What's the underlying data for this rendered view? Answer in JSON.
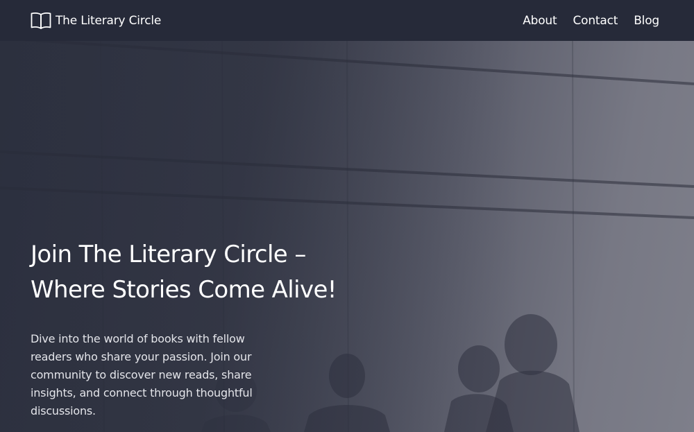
{
  "header": {
    "brand_name": "The Literary Circle",
    "brand_icon": "open-book-icon",
    "nav": [
      "About",
      "Contact",
      "Blog"
    ]
  },
  "hero": {
    "title_line1": "Join The Literary Circle –",
    "title_line2": "Where Stories Come Alive!",
    "description": "Dive into the world of books with fellow readers who share your passion. Join our community to discover new reads, share insights, and connect through thoughtful discussions."
  },
  "colors": {
    "header_bg": "#262a39",
    "text": "#ffffff",
    "hero_overlay": "#3b3e4c"
  }
}
